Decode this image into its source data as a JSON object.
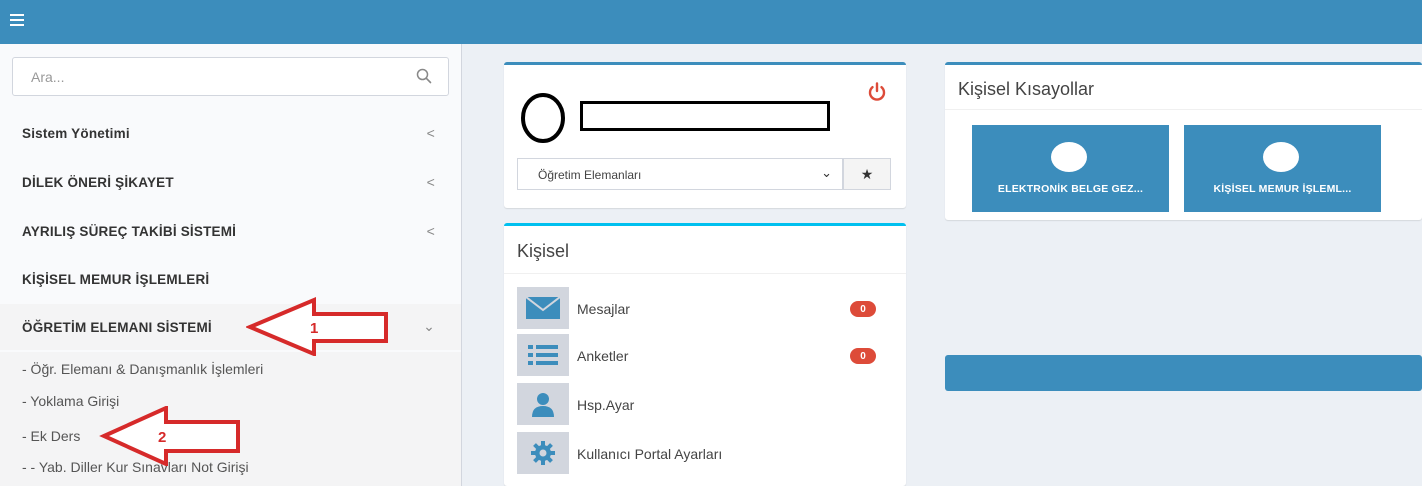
{
  "header": {
    "menu_icon": "hamburger-icon",
    "bg_color": "#3c8dbc"
  },
  "sidebar": {
    "search": {
      "placeholder": "Ara...",
      "icon": "search-icon"
    },
    "items": [
      {
        "label": "Sistem Yönetimi",
        "chevron": "<"
      },
      {
        "label": "DİLEK ÖNERİ ŞİKAYET",
        "chevron": "<"
      },
      {
        "label": "AYRILIŞ SÜREÇ TAKİBİ SİSTEMİ",
        "chevron": "<"
      },
      {
        "label": "KİŞİSEL MEMUR İŞLEMLERİ",
        "chevron": ""
      },
      {
        "label": "ÖĞRETİM ELEMANI SİSTEMİ",
        "chevron": "⌄"
      }
    ],
    "sub_items": [
      "- Öğr. Elemanı & Danışmanlık İşlemleri",
      "- Yoklama Girişi",
      "- Ek Ders",
      "- - Yab. Diller Kur Sınavları Not Girişi"
    ]
  },
  "annotations": [
    {
      "number": "1",
      "color": "#d62a2a"
    },
    {
      "number": "2",
      "color": "#d62a2a"
    }
  ],
  "profile": {
    "role_select": {
      "value": "Öğretim Elemanları",
      "caret": "⌄"
    },
    "star_label": "★",
    "power_icon": "power-icon"
  },
  "personal": {
    "title": "Kişisel",
    "rows": [
      {
        "label": "Mesajlar",
        "icon": "envelope-icon",
        "badge": "0"
      },
      {
        "label": "Anketler",
        "icon": "list-icon",
        "badge": "0"
      },
      {
        "label": "Hsp.Ayar",
        "icon": "user-icon",
        "badge": ""
      },
      {
        "label": "Kullanıcı Portal Ayarları",
        "icon": "gear-icon",
        "badge": ""
      }
    ]
  },
  "shortcuts": {
    "title": "Kişisel Kısayollar",
    "tiles": [
      {
        "label": "ELEKTRONİK BELGE GEZ..."
      },
      {
        "label": "KİŞİSEL MEMUR İŞLEML..."
      }
    ]
  },
  "colors": {
    "primary": "#3c8dbc",
    "info": "#00c0ef",
    "danger": "#dd4b39",
    "annotation": "#d62a2a"
  }
}
